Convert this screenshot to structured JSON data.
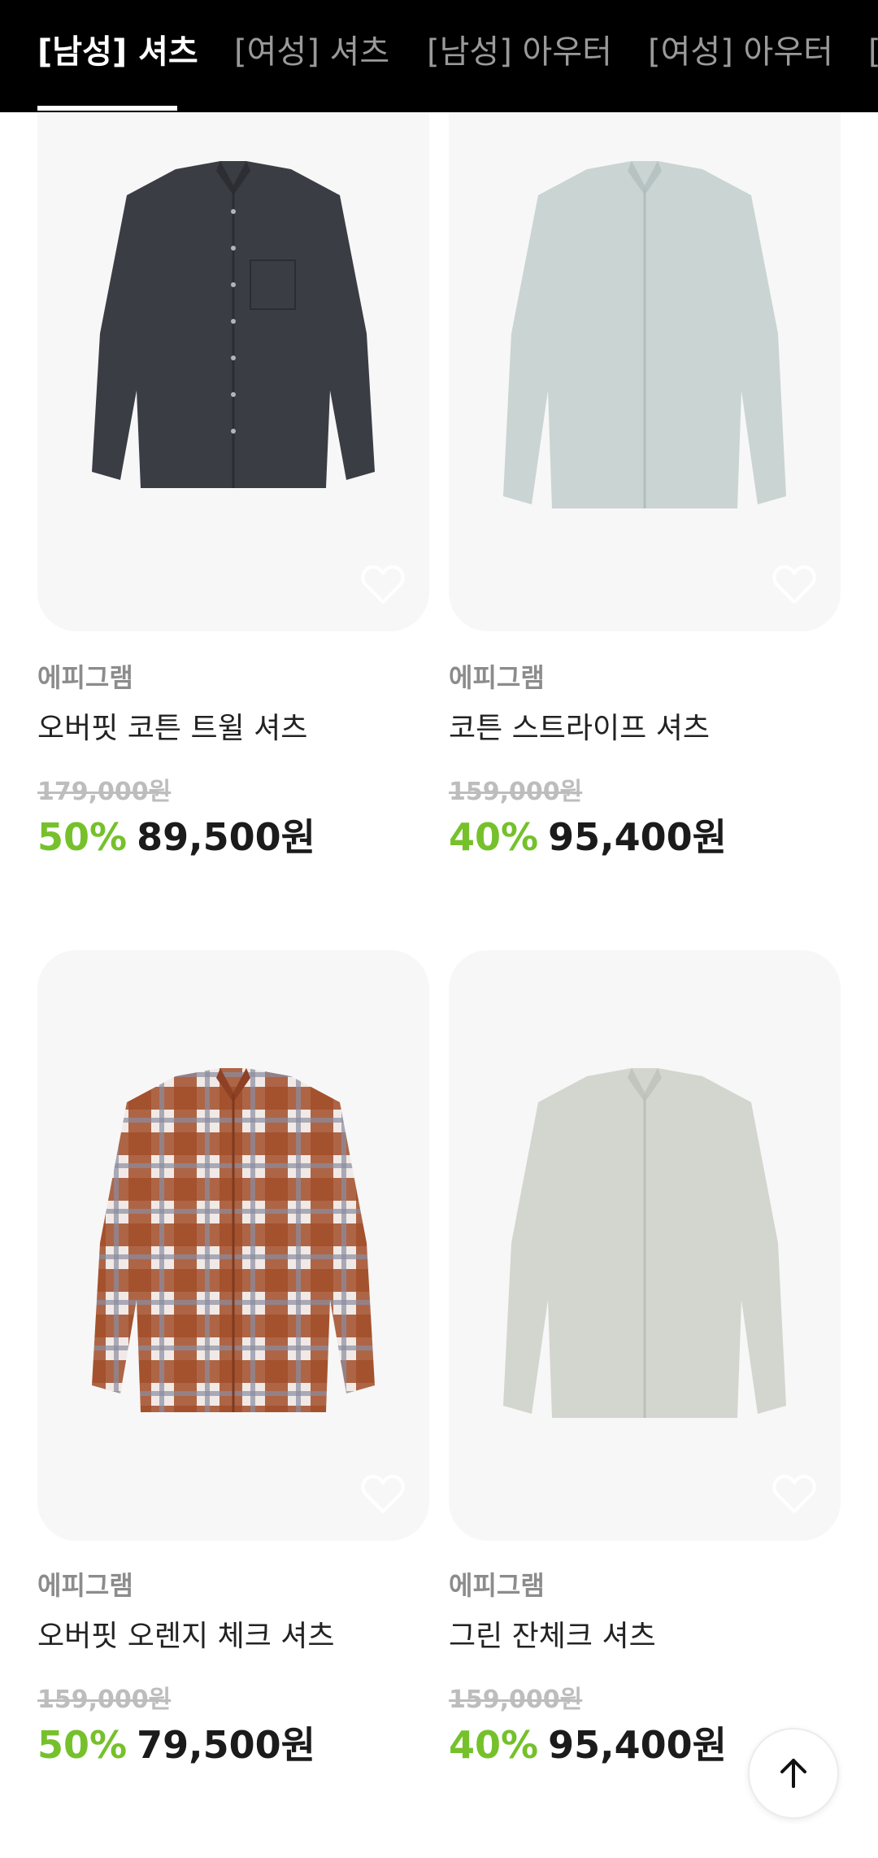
{
  "tabs": [
    {
      "label": "[남성] 셔츠",
      "active": true
    },
    {
      "label": "[여성] 셔츠",
      "active": false
    },
    {
      "label": "[남성] 아우터",
      "active": false
    },
    {
      "label": "[여성] 아우터",
      "active": false
    },
    {
      "label": "[",
      "active": false
    }
  ],
  "products": [
    {
      "brand": "에피그램",
      "name": "오버핏 코튼 트윌 셔츠",
      "original_price": "179,000원",
      "discount": "50%",
      "sale_price": "89,500원",
      "shirt_color": "#3b3d44",
      "pattern": "solid"
    },
    {
      "brand": "에피그램",
      "name": "코튼 스트라이프 셔츠",
      "original_price": "159,000원",
      "discount": "40%",
      "sale_price": "95,400원",
      "shirt_color": "#c9d4d3",
      "pattern": "solid"
    },
    {
      "brand": "에피그램",
      "name": "오버핏 오렌지 체크 셔츠",
      "original_price": "159,000원",
      "discount": "50%",
      "sale_price": "79,500원",
      "shirt_color": "#a24e2a",
      "pattern": "plaid"
    },
    {
      "brand": "에피그램",
      "name": "그린 잔체크 셔츠",
      "original_price": "159,000원",
      "discount": "40%",
      "sale_price": "95,400원",
      "shirt_color": "#d3d6cf",
      "pattern": "solid"
    }
  ],
  "colors": {
    "accent_discount": "#76c12b",
    "tabbar_bg": "#000000"
  },
  "icons": {
    "wishlist": "heart-outline-icon",
    "scroll_top": "arrow-up-icon"
  }
}
